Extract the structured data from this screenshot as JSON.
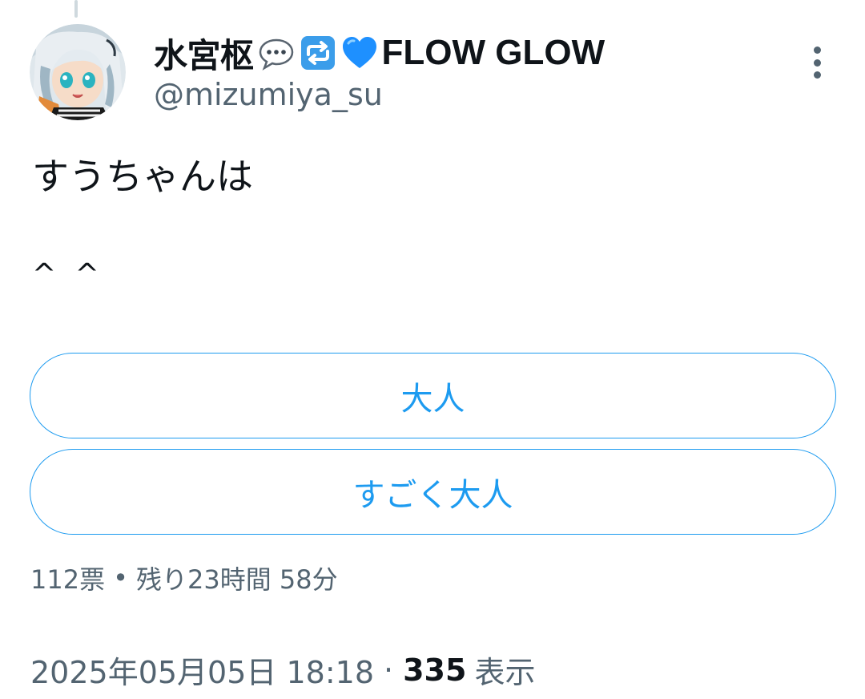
{
  "author": {
    "display_name": "水宮枢",
    "name_emojis": [
      "speech-bubble-icon",
      "repeat-arrows-icon",
      "blue-heart-icon"
    ],
    "name_suffix": "FLOW GLOW",
    "handle": "@mizumiya_su"
  },
  "tweet": {
    "text_line1": "すうちゃんは",
    "text_line2": "^ ^"
  },
  "poll": {
    "options": [
      {
        "label": "大人"
      },
      {
        "label": "すごく大人"
      }
    ],
    "votes": "112票",
    "separator": "•",
    "remaining": "残り23時間 58分"
  },
  "meta": {
    "timestamp": "2025年05月05日 18:18",
    "separator": "·",
    "views_count": "335",
    "views_label": "表示"
  },
  "colors": {
    "accent": "#1d9bf0",
    "text_primary": "#0f1419",
    "text_secondary": "#536471",
    "heart_blue": "#1e90ff"
  }
}
